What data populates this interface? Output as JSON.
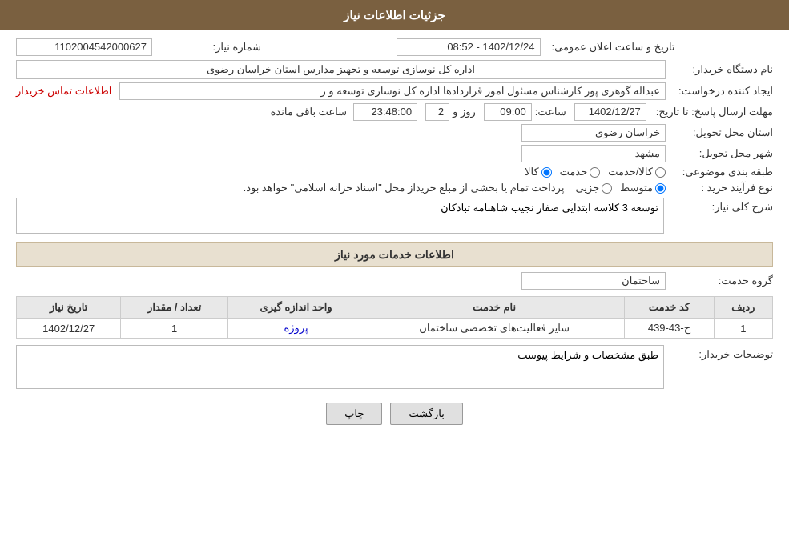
{
  "header": {
    "title": "جزئیات اطلاعات نیاز"
  },
  "fields": {
    "shomara_niaz_label": "شماره نیاز:",
    "shomara_niaz_value": "1102004542000627",
    "nam_dastgah_label": "نام دستگاه خریدار:",
    "nam_dastgah_value": "اداره کل نوسازی  توسعه و تجهیز مدارس استان خراسان رضوی",
    "ijad_konande_label": "ایجاد کننده درخواست:",
    "ijad_konande_value": "عبداله گوهری پور کارشناس مسئول امور قراردادها  اداره کل نوسازی  توسعه و ز",
    "contact_link": "اطلاعات تماس خریدار",
    "mohlat_label": "مهلت ارسال پاسخ: تا تاریخ:",
    "mohlat_date": "1402/12/27",
    "mohlat_saat_label": "ساعت:",
    "mohlat_saat": "09:00",
    "mohlat_rooz_label": "روز و",
    "mohlat_rooz": "2",
    "mohlat_remaining_label": "ساعت باقی مانده",
    "mohlat_remaining": "23:48:00",
    "ostan_label": "استان محل تحویل:",
    "ostan_value": "خراسان رضوی",
    "shahr_label": "شهر محل تحویل:",
    "shahr_value": "مشهد",
    "tabaghe_label": "طبقه بندی موضوعی:",
    "tabaghe_kala": "کالا",
    "tabaghe_khadamat": "خدمت",
    "tabaghe_kala_khadamat": "کالا/خدمت",
    "tabaghe_selected": "کالا",
    "nooe_farayand_label": "نوع فرآیند خرید :",
    "nooe_farayand_jozii": "جزیی",
    "nooe_farayand_motavaset": "متوسط",
    "nooe_farayand_desc": "پرداخت تمام یا بخشی از مبلغ خریداز محل \"اسناد خزانه اسلامی\" خواهد بود.",
    "nooe_farayand_selected": "متوسط",
    "sharh_label": "شرح کلی نیاز:",
    "sharh_value": "توسعه 3 کلاسه ابتدایی صفار نجیب شاهنامه تبادکان",
    "khadamat_section": "اطلاعات خدمات مورد نیاز",
    "grooh_khadamat_label": "گروه خدمت:",
    "grooh_khadamat_value": "ساختمان",
    "tarikh_elan_label": "تاریخ و ساعت اعلان عمومی:",
    "tarikh_elan_value": "1402/12/24 - 08:52"
  },
  "table": {
    "headers": [
      "ردیف",
      "کد خدمت",
      "نام خدمت",
      "واحد اندازه گیری",
      "تعداد / مقدار",
      "تاریخ نیاز"
    ],
    "rows": [
      {
        "radif": "1",
        "kod_khadamat": "ج-43-439",
        "nam_khadamat": "سایر فعالیت‌های تخصصی ساختمان",
        "vahed": "پروژه",
        "tedad": "1",
        "tarikh": "1402/12/27"
      }
    ]
  },
  "tozi_hat": {
    "label": "توضیحات خریدار:",
    "value": "طبق مشخصات و شرایط پیوست"
  },
  "buttons": {
    "print": "چاپ",
    "back": "بازگشت"
  }
}
